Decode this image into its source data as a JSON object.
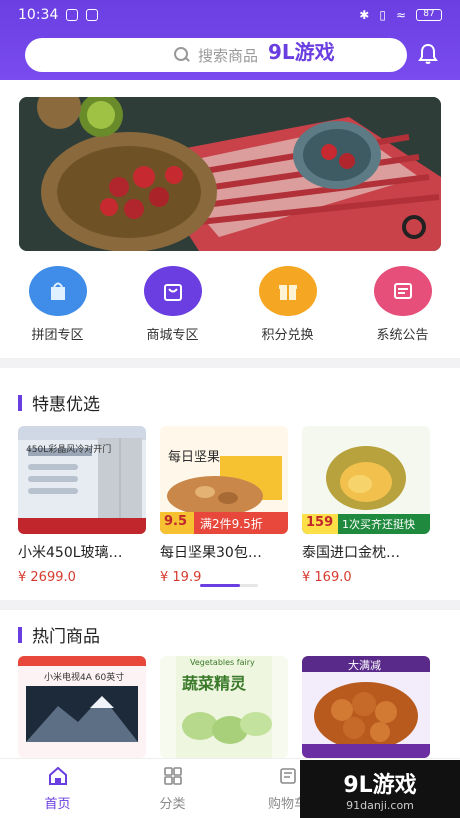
{
  "status_bar": {
    "time": "10:34",
    "battery": "87"
  },
  "search": {
    "placeholder": "搜索商品"
  },
  "quick_links": [
    {
      "label": "拼团专区",
      "icon": "bag-icon",
      "color": "#3f8de8"
    },
    {
      "label": "商城专区",
      "icon": "shopping-bag-icon",
      "color": "#6a3ee0"
    },
    {
      "label": "积分兑换",
      "icon": "gift-icon",
      "color": "#f5a623"
    },
    {
      "label": "系统公告",
      "icon": "notice-icon",
      "color": "#e64f7a"
    }
  ],
  "specials": {
    "title": "特惠优选",
    "items": [
      {
        "name": "小米450L玻璃…",
        "price": "¥ 2699.0",
        "tag": "",
        "image_text": "450L彩晶风冷对开门"
      },
      {
        "name": "每日坚果30包…",
        "price": "¥ 19.9",
        "tag": "9.5",
        "image_text": "每日坚果",
        "promo": "满2件9.5折"
      },
      {
        "name": "泰国进口金枕…",
        "price": "¥ 169.0",
        "tag": "159",
        "image_text": "",
        "promo": "1次买齐还挺快"
      }
    ]
  },
  "hot": {
    "title": "热门商品",
    "items": [
      {
        "image_text": "小米电视4A 60英寸"
      },
      {
        "image_text": "蔬菜精灵",
        "image_sub": "Vegetables fairy"
      },
      {
        "image_text": "大满减"
      }
    ]
  },
  "tabbar": [
    {
      "label": "首页",
      "icon": "home-icon",
      "active": true
    },
    {
      "label": "分类",
      "icon": "grid-icon",
      "active": false
    },
    {
      "label": "购物车",
      "icon": "cart-icon",
      "active": false
    }
  ],
  "watermark": {
    "logo": "9L游戏",
    "url": "91danji.com"
  },
  "colors": {
    "accent": "#6a3ee0",
    "price": "#d63a2f"
  }
}
